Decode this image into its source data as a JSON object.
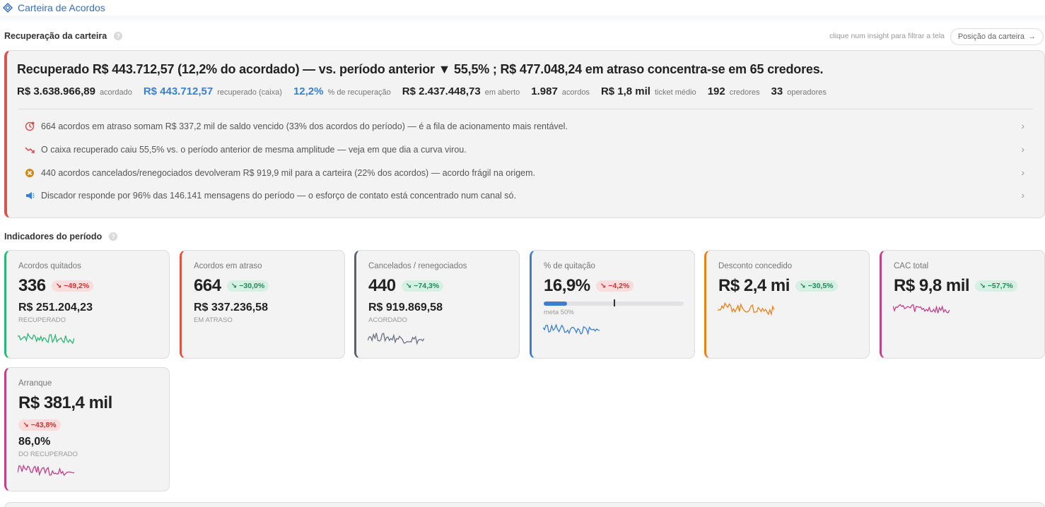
{
  "app": {
    "title": "Carteira de Acordos"
  },
  "recovery_section": {
    "title": "Recuperação da carteira",
    "hint": "clique num insight para filtrar a tela",
    "position_button": "Posição da carteira",
    "headline": "Recuperado R$ 443.712,57 (12,2% do acordado) — vs. período anterior ▼ 55,5% ; R$ 477.048,24 em atraso concentra-se em 65 credores.",
    "stats": [
      {
        "value": "R$ 3.638.966,89",
        "label": "acordado"
      },
      {
        "value": "R$ 443.712,57",
        "label": "recuperado (caixa)"
      },
      {
        "value": "12,2%",
        "label": "% de recuperação"
      },
      {
        "value": "R$ 2.437.448,73",
        "label": "em aberto"
      },
      {
        "value": "1.987",
        "label": "acordos"
      },
      {
        "value": "R$ 1,8 mil",
        "label": "ticket médio"
      },
      {
        "value": "192",
        "label": "credores"
      },
      {
        "value": "33",
        "label": "operadores"
      }
    ],
    "insights": [
      {
        "icon": "overdue-clock-icon",
        "text": "664 acordos em atraso somam R$ 337,2 mil de saldo vencido (33% dos acordos do período) — é a fila de acionamento mais rentável."
      },
      {
        "icon": "trend-down-icon",
        "text": "O caixa recuperado caiu 55,5% vs. o período anterior de mesma amplitude — veja em que dia a curva virou."
      },
      {
        "icon": "cancel-circle-icon",
        "text": "440 acordos cancelados/renegociados devolveram R$ 919,9 mil para a carteira (22% dos acordos) — acordo frágil na origem."
      },
      {
        "icon": "megaphone-icon",
        "text": "Discador responde por 96% das 146.141 mensagens do período — o esforço de contato está concentrado num canal só."
      }
    ]
  },
  "indicators": {
    "title": "Indicadores do período",
    "cards": [
      {
        "title": "Acordos quitados",
        "value": "336",
        "delta": "−49,2%",
        "sub": "R$ 251.204,23",
        "sub_label": "RECUPERADO"
      },
      {
        "title": "Acordos em atraso",
        "value": "664",
        "delta": "−30,0%",
        "sub": "R$ 337.236,58",
        "sub_label": "EM ATRASO"
      },
      {
        "title": "Cancelados / renegociados",
        "value": "440",
        "delta": "−74,3%",
        "sub": "R$ 919.869,58",
        "sub_label": "ACORDADO"
      },
      {
        "title": "% de quitação",
        "value": "16,9%",
        "delta": "−4,2%",
        "progress": 0.169,
        "target": 0.5,
        "meta_label": "meta 50%"
      },
      {
        "title": "Desconto concedido",
        "value": "R$ 2,4 mi",
        "delta": "−30,5%"
      },
      {
        "title": "CAC total",
        "value": "R$ 9,8 mil",
        "delta": "−57,7%"
      },
      {
        "title": "Arranque",
        "value": "R$ 381,4 mil",
        "delta": "−43,8%",
        "sub": "86,0%",
        "sub_label": "DO RECUPERADO"
      }
    ]
  },
  "colors": {
    "accent_blue": "#3b7fd1",
    "quitados": "#2bb673",
    "atraso": "#e0533f",
    "cancelados": "#5a6170",
    "quitacao": "#3b7fd1",
    "desconto": "#e8821e",
    "cac": "#c0408a",
    "arranque": "#c0408a",
    "recovery_border": "#d9534f"
  }
}
